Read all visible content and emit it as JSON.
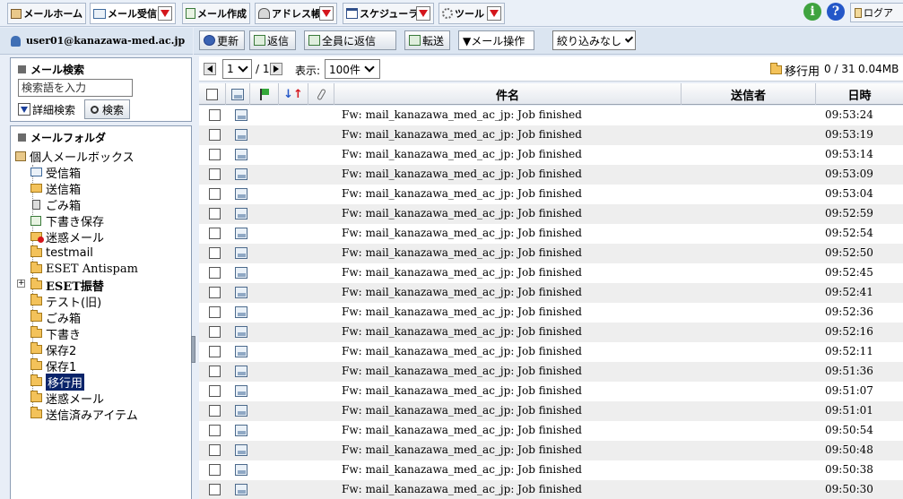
{
  "tabs": {
    "mail_home": "メールホーム",
    "mail_receive": "メール受信",
    "mail_compose": "メール作成",
    "address_book": "アドレス帳",
    "schedule": "スケジューラ",
    "tools": "ツール",
    "logout": "ログア"
  },
  "user": {
    "email": "user01@kanazawa-med.ac.jp"
  },
  "toolbar": {
    "refresh": "更新",
    "reply": "返信",
    "reply_all": "全員に返信",
    "forward": "転送",
    "mail_ops": "▼メール操作",
    "filter": "絞り込みなし"
  },
  "search": {
    "title": "メール検索",
    "placeholder": "検索語を入力",
    "advanced": "詳細検索",
    "button": "検索"
  },
  "folders": {
    "title": "メールフォルダ",
    "root": "個人メールボックス",
    "items": [
      "受信箱",
      "送信箱",
      "ごみ箱",
      "下書き保存",
      "迷惑メール",
      "testmail",
      "ESET Antispam",
      "ESET振替",
      "テスト(旧)",
      "ごみ箱",
      "下書き",
      "保存2",
      "保存1",
      "移行用",
      "迷惑メール",
      "送信済みアイテム"
    ],
    "selected": "移行用"
  },
  "pager": {
    "page": "1",
    "total": "/ 1",
    "display_label": "表示:",
    "page_size": "100件",
    "folder": "移行用",
    "count": "0 / 31",
    "size": "0.04MB"
  },
  "columns": {
    "subject": "件名",
    "sender": "送信者",
    "date": "日時"
  },
  "messages": [
    {
      "subject": "Fw: mail_kanazawa_med_ac_jp: Job finished",
      "time": "09:53:24"
    },
    {
      "subject": "Fw: mail_kanazawa_med_ac_jp: Job finished",
      "time": "09:53:19"
    },
    {
      "subject": "Fw: mail_kanazawa_med_ac_jp: Job finished",
      "time": "09:53:14"
    },
    {
      "subject": "Fw: mail_kanazawa_med_ac_jp: Job finished",
      "time": "09:53:09"
    },
    {
      "subject": "Fw: mail_kanazawa_med_ac_jp: Job finished",
      "time": "09:53:04"
    },
    {
      "subject": "Fw: mail_kanazawa_med_ac_jp: Job finished",
      "time": "09:52:59"
    },
    {
      "subject": "Fw: mail_kanazawa_med_ac_jp: Job finished",
      "time": "09:52:54"
    },
    {
      "subject": "Fw: mail_kanazawa_med_ac_jp: Job finished",
      "time": "09:52:50"
    },
    {
      "subject": "Fw: mail_kanazawa_med_ac_jp: Job finished",
      "time": "09:52:45"
    },
    {
      "subject": "Fw: mail_kanazawa_med_ac_jp: Job finished",
      "time": "09:52:41"
    },
    {
      "subject": "Fw: mail_kanazawa_med_ac_jp: Job finished",
      "time": "09:52:36"
    },
    {
      "subject": "Fw: mail_kanazawa_med_ac_jp: Job finished",
      "time": "09:52:16"
    },
    {
      "subject": "Fw: mail_kanazawa_med_ac_jp: Job finished",
      "time": "09:52:11"
    },
    {
      "subject": "Fw: mail_kanazawa_med_ac_jp: Job finished",
      "time": "09:51:36"
    },
    {
      "subject": "Fw: mail_kanazawa_med_ac_jp: Job finished",
      "time": "09:51:07"
    },
    {
      "subject": "Fw: mail_kanazawa_med_ac_jp: Job finished",
      "time": "09:51:01"
    },
    {
      "subject": "Fw: mail_kanazawa_med_ac_jp: Job finished",
      "time": "09:50:54"
    },
    {
      "subject": "Fw: mail_kanazawa_med_ac_jp: Job finished",
      "time": "09:50:48"
    },
    {
      "subject": "Fw: mail_kanazawa_med_ac_jp: Job finished",
      "time": "09:50:38"
    },
    {
      "subject": "Fw: mail_kanazawa_med_ac_jp: Job finished",
      "time": "09:50:30"
    }
  ],
  "icons": {
    "info": "info-icon",
    "help": "help-icon",
    "info_color": "#3fa33f",
    "help_color": "#2457c8",
    "selected_folder_bg": "#0a246a",
    "dropdown_arrow_color": "#d4161c"
  }
}
